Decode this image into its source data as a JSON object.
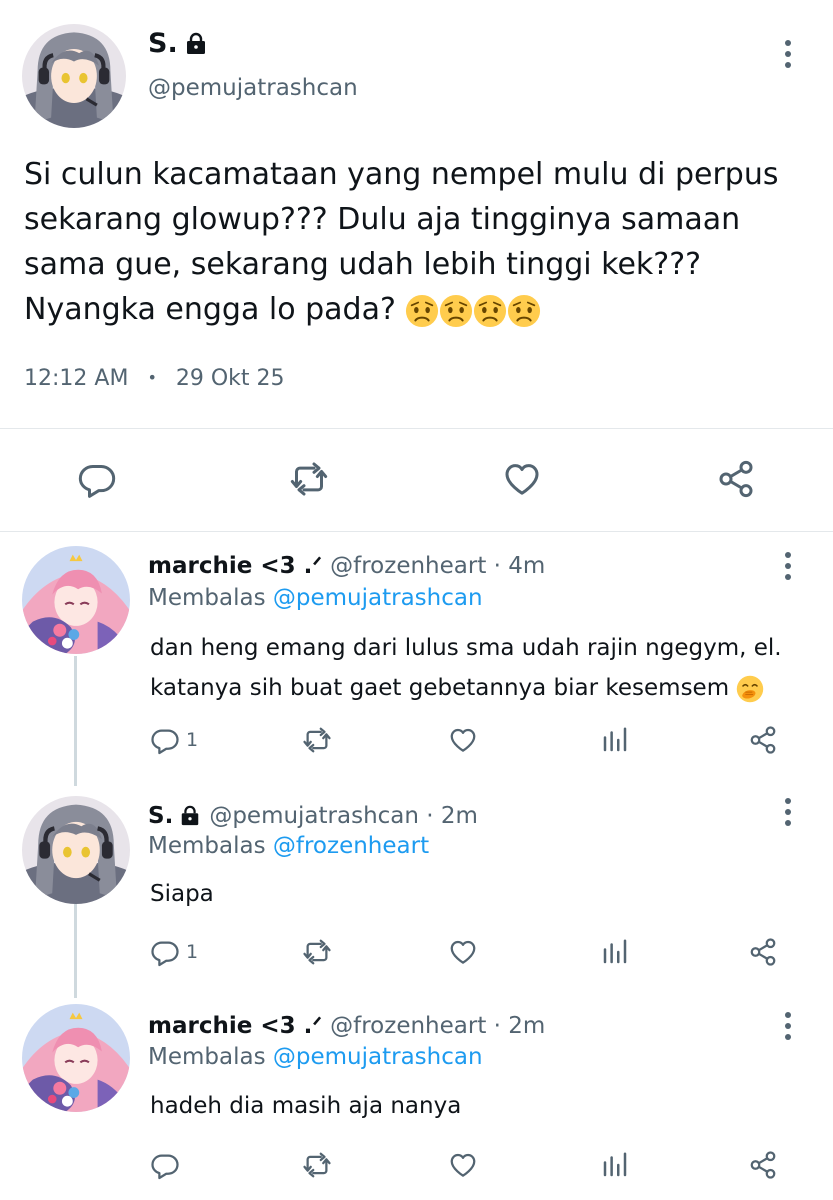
{
  "main_tweet": {
    "name": "S.",
    "handle": "@pemujatrashcan",
    "text": "Si culun kacamataan yang nempel mulu di perpus sekarang glowup??? Dulu aja tingginya samaan sama gue, sekarang udah lebih tinggi kek??? Nyangka engga lo pada?",
    "time": "12:12 AM",
    "dot": "•",
    "date": "29 Okt 25",
    "emojis": [
      "worried-face",
      "worried-face",
      "worried-face",
      "worried-face"
    ]
  },
  "replies": [
    {
      "name": "marchie <3 .ᐟ",
      "handle": "@frozenheart · 4m",
      "replying_label": "Membalas",
      "replying_to": "@pemujatrashcan",
      "text": "dan heng emang dari lulus sma udah rajin ngegym, el.\nkatanya sih buat gaet gebetannya biar kesemsem",
      "trailing_emoji": "face-with-hand-over-mouth",
      "reply_count": "1",
      "avatar": "pink-hair-avatar"
    },
    {
      "name": "S.",
      "handle": "@pemujatrashcan · 2m",
      "replying_label": "Membalas",
      "replying_to": "@frozenheart",
      "text": "Siapa",
      "reply_count": "1",
      "avatar": "grey-hair-avatar"
    },
    {
      "name": "marchie <3 .ᐟ",
      "handle": "@frozenheart · 2m",
      "replying_label": "Membalas",
      "replying_to": "@pemujatrashcan",
      "text": "hadeh dia masih aja nanya",
      "reply_count": "",
      "avatar": "pink-hair-avatar"
    }
  ],
  "colors": {
    "text": "#0f1419",
    "secondary": "#536471",
    "link": "#1d9bf0",
    "divider": "#e4e8eb",
    "thread_line": "#cfd9de"
  }
}
